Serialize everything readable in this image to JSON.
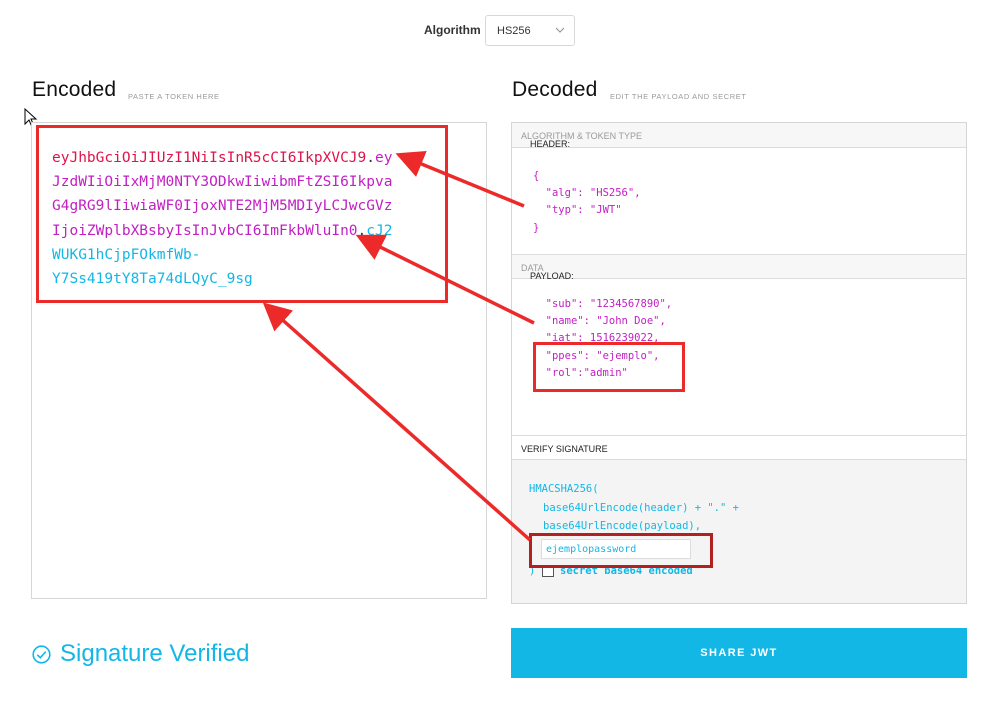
{
  "algorithm": {
    "label": "Algorithm",
    "value": "HS256"
  },
  "encoded": {
    "title": "Encoded",
    "subtitle": "PASTE A TOKEN HERE",
    "token_lines": [
      {
        "red": "eyJhbGciOiJIUzI1NiIsInR5cCI6IkpXVCJ9",
        "dot": ".",
        "mag": "ey"
      },
      {
        "mag": "JzdWIiOiIxMjM0NTY3ODkwIiwibmFtZSI6Ikpva"
      },
      {
        "mag": "G4gRG9lIiwiaWF0IjoxNTE2MjM5MDIyLCJwcGVz"
      },
      {
        "mag": "IjoiZWplbXBsbyIsInJvbCI6ImFkbWluIn0",
        "dot": ".",
        "cyan": "cJ2"
      },
      {
        "cyan": "WUKG1hCjpFOkmfWb-"
      },
      {
        "cyan": "Y7Ss419tY8Ta74dLQyC_9sg"
      }
    ]
  },
  "decoded": {
    "title": "Decoded",
    "subtitle": "EDIT THE PAYLOAD AND SECRET",
    "header_section": {
      "label": "HEADER:",
      "desc": "ALGORITHM & TOKEN TYPE"
    },
    "header_json": {
      "open": "{",
      "alg_key": "\"alg\"",
      "alg_val": "\"HS256\"",
      "typ_key": "\"typ\"",
      "typ_val": "\"JWT\"",
      "close": "}"
    },
    "payload_section": {
      "label": "PAYLOAD:",
      "desc": "DATA"
    },
    "payload_json": {
      "sub_key": "\"sub\"",
      "sub_val": "\"1234567890\"",
      "name_key": "\"name\"",
      "name_val": "\"John Doe\"",
      "iat_key": "\"iat\"",
      "iat_val": "1516239022",
      "ppes_key": "\"ppes\"",
      "ppes_val": "\"ejemplo\"",
      "rol_key": "\"rol\"",
      "rol_val": "\"admin\""
    },
    "verify_section": {
      "label": "VERIFY SIGNATURE"
    },
    "verify": {
      "func": "HMACSHA256(",
      "line1": "base64UrlEncode(header) + \".\" +",
      "line2": "base64UrlEncode(payload),",
      "secret": "ejemplopassword",
      "close": ")",
      "b64_label": "secret base64 encoded"
    }
  },
  "status": {
    "verified": "Signature Verified"
  },
  "share_button": "SHARE JWT",
  "colors": {
    "accent": "#12b7e6",
    "header_red": "#e0134a",
    "payload_magenta": "#c21fc4",
    "annotation_red": "#ec2a2a"
  }
}
